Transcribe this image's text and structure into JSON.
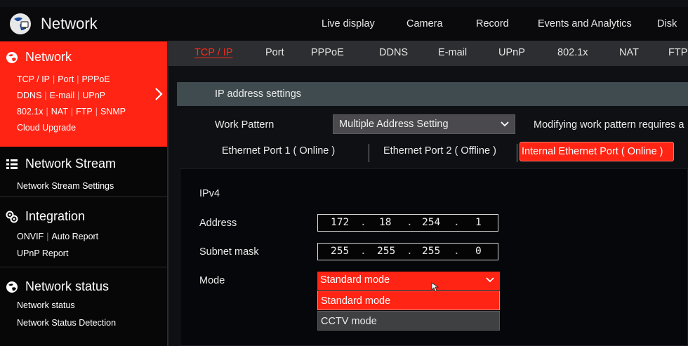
{
  "app": {
    "title": "Network",
    "logo_icon": "network-globe-icon"
  },
  "top_nav": [
    "Live display",
    "Camera",
    "Record",
    "Events and Analytics",
    "Disk"
  ],
  "sidebar": {
    "groups": [
      {
        "title": "Network",
        "icon": "network-globe-icon",
        "active": true,
        "lines": [
          [
            "TCP / IP",
            "Port",
            "PPPoE"
          ],
          [
            "DDNS",
            "E-mail",
            "UPnP"
          ],
          [
            "802.1x",
            "NAT",
            "FTP",
            "SNMP"
          ],
          [
            "Cloud Upgrade"
          ]
        ]
      },
      {
        "title": "Network Stream",
        "icon": "list-icon",
        "lines": [
          [
            "Network Stream Settings"
          ]
        ]
      },
      {
        "title": "Integration",
        "icon": "integration-icon",
        "lines": [
          [
            "ONVIF",
            "Auto Report"
          ],
          [
            "UPnP Report"
          ]
        ]
      },
      {
        "title": "Network status",
        "icon": "network-globe-icon",
        "lines": [
          [
            "Network status"
          ],
          [
            "Network Status Detection"
          ]
        ]
      }
    ]
  },
  "sub_tabs": [
    "TCP / IP",
    "Port",
    "PPPoE",
    "DDNS",
    "E-mail",
    "UPnP",
    "802.1x",
    "NAT",
    "FTP"
  ],
  "selected_sub_tab": "TCP / IP",
  "section_title": "IP address settings",
  "work_pattern": {
    "label": "Work Pattern",
    "value": "Multiple Address Setting",
    "note": "Modifying work pattern requires a"
  },
  "port_tabs": [
    "Ethernet Port 1 ( Online )",
    "Ethernet Port 2 ( Offline )",
    "Internal Ethernet Port ( Online )"
  ],
  "selected_port_tab": "Internal Ethernet Port ( Online )",
  "ipv4": {
    "title": "IPv4",
    "address_label": "Address",
    "address": [
      "172",
      "18",
      "254",
      "1"
    ],
    "subnet_label": "Subnet mask",
    "subnet": [
      "255",
      "255",
      "255",
      "0"
    ],
    "mode_label": "Mode",
    "mode_value": "Standard mode",
    "mode_options": [
      "Standard mode",
      "CCTV mode"
    ]
  },
  "colors": {
    "accent": "#ff2414",
    "background": "#0f1013",
    "section_bar": "#3f4b4e"
  }
}
